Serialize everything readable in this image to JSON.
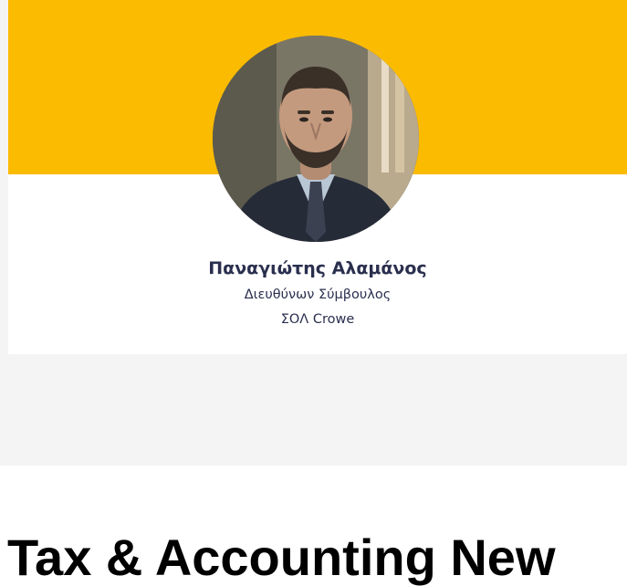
{
  "profile": {
    "name": "Παναγιώτης Αλαμάνος",
    "role": "Διευθύνων Σύμβουλος",
    "company": "ΣΟΛ Crowe"
  },
  "section": {
    "heading": "Tax & Accounting New"
  },
  "colors": {
    "banner": "#fbbb00",
    "text": "#2a2f4e",
    "background": "#f4f4f4"
  }
}
